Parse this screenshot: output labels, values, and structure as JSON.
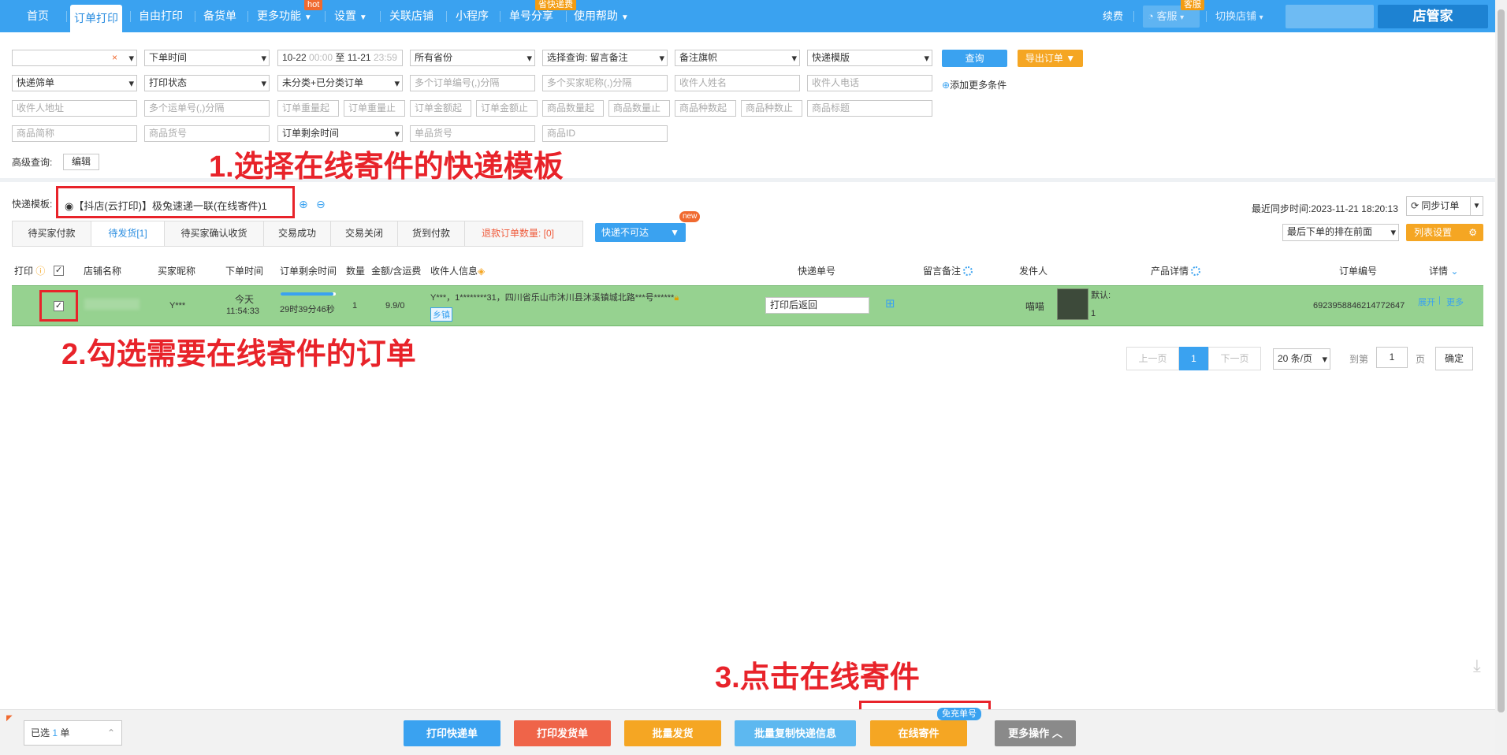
{
  "nav": {
    "items": [
      "首页",
      "订单打印",
      "自由打印",
      "备货单",
      "更多功能",
      "设置",
      "关联店铺",
      "小程序",
      "单号分享",
      "使用帮助"
    ],
    "badge_hot": "hot",
    "badge_share": "省快递费",
    "renew": "续费",
    "service": "客服",
    "service_badge": "客服",
    "switch_shop": "切换店铺",
    "brand": "店管家"
  },
  "filters": {
    "order_time": "下单时间",
    "date_from": "10-22",
    "time_from": "00:00",
    "date_to_sep": "至",
    "date_to": "11-21",
    "time_to": "23:59",
    "province": "所有省份",
    "select_query": "选择查询: 留言备注",
    "flag": "备注旗帜",
    "express_template": "快递模版",
    "query_btn": "查询",
    "export_btn": "导出订单 ▼",
    "express_type": "快递筛单",
    "print_status": "打印状态",
    "category": "未分类+已分类订单",
    "ph_order_no": "多个订单编号(,)分隔",
    "ph_buyer_nick": "多个买家昵称(,)分隔",
    "ph_receiver_name": "收件人姓名",
    "ph_receiver_phone": "收件人电话",
    "add_more": "添加更多条件",
    "ph_address": "收件人地址",
    "ph_waybill": "多个运单号(,)分隔",
    "ph_weight_from": "订单重量起",
    "ph_weight_to": "订单重量止",
    "ph_amount_from": "订单金额起",
    "ph_amount_to": "订单金额止",
    "ph_qty_from": "商品数量起",
    "ph_qty_to": "商品数量止",
    "ph_kind_from": "商品种数起",
    "ph_kind_to": "商品种数止",
    "ph_title": "商品标题",
    "ph_short_name": "商品简称",
    "ph_sku": "商品货号",
    "remain_time": "订单剩余时间",
    "ph_single_sku": "单品货号",
    "ph_product_id": "商品ID",
    "advanced_label": "高级查询:",
    "edit_btn": "编辑"
  },
  "template": {
    "label": "快递模板:",
    "option": "【抖店(云打印)】极兔速递一联(在线寄件)1",
    "last_sync": "最近同步时间:2023-11-21 18:20:13",
    "sync_btn": "同步订单",
    "sort_select": "最后下单的排在前面",
    "list_settings": "列表设置"
  },
  "tabs": [
    "待买家付款",
    "待发货[1]",
    "待买家确认收货",
    "交易成功",
    "交易关闭",
    "货到付款"
  ],
  "refund_label": "退款订单数量:",
  "refund_count": "[0]",
  "express_unreachable": "快递不可达",
  "new_badge": "new",
  "table": {
    "headers": [
      "打印",
      "店铺名称",
      "买家昵称",
      "下单时间",
      "订单剩余时间",
      "数量",
      "金额/含运费",
      "收件人信息",
      "快递单号",
      "留言备注",
      "发件人",
      "产品详情",
      "订单编号",
      "详情"
    ],
    "row": {
      "buyer": "Y***",
      "order_day": "今天",
      "order_time": "11:54:33",
      "remaining": "29时39分46秒",
      "remaining_progress": 0.95,
      "qty": "1",
      "amount": "9.9/0",
      "receiver": "Y***，1********31，四川省乐山市沐川县沐溪镇城北路***号******",
      "tag": "乡镇",
      "waybill": "打印后返回",
      "sender": "喵喵",
      "product_default": "默认:",
      "product_qty": "1",
      "order_no": "6923958846214772647",
      "expand": "展开",
      "more": "更多"
    }
  },
  "pagination": {
    "prev": "上一页",
    "current": "1",
    "next": "下一页",
    "page_size": "20 条/页",
    "goto": "到第",
    "page_input": "1",
    "page_unit": "页",
    "confirm": "确定"
  },
  "annotations": {
    "step1": "1.选择在线寄件的快递模板",
    "step2": "2.勾选需要在线寄件的订单",
    "step3": "3.点击在线寄件"
  },
  "bottom": {
    "selected_prefix": "已选",
    "selected_count": "1",
    "selected_unit": "单",
    "buttons": [
      "打印快递单",
      "打印发货单",
      "批量发货",
      "批量复制快递信息",
      "在线寄件",
      "更多操作"
    ],
    "free_badge": "免充单号"
  },
  "colors": {
    "nav_blue": "#3aa2f0",
    "row_green": "#96d290",
    "annotation_red": "#e8232a",
    "orange": "#f5a623"
  }
}
